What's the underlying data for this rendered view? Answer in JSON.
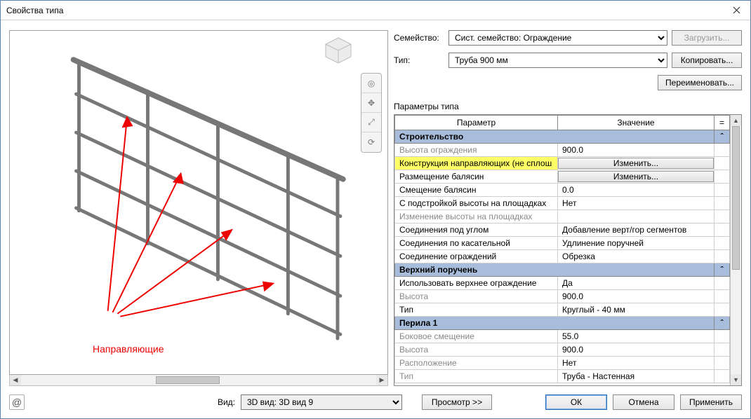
{
  "window": {
    "title": "Свойства типа"
  },
  "form": {
    "family_label": "Семейство:",
    "family_value": "Сист. семейство: Ограждение",
    "type_label": "Тип:",
    "type_value": "Труба 900 мм",
    "load_btn": "Загрузить...",
    "copy_btn": "Копировать...",
    "rename_btn": "Переименовать..."
  },
  "grid": {
    "section_label": "Параметры типа",
    "col_param": "Параметр",
    "col_value": "Значение",
    "col_eq": "=",
    "edit_label": "Изменить...",
    "groups": [
      {
        "title": "Строительство",
        "rows": [
          {
            "param": "Высота ограждения",
            "value": "900.0",
            "dim": true
          },
          {
            "param": "Конструкция направляющих (не сплош",
            "value_btn": true,
            "highlight": true
          },
          {
            "param": "Размещение балясин",
            "value_btn": true
          },
          {
            "param": "Смещение балясин",
            "value": "0.0"
          },
          {
            "param": "С подстройкой высоты на площадках",
            "value": "Нет"
          },
          {
            "param": "Изменение высоты на площадках",
            "value": "",
            "dim": true
          },
          {
            "param": "Соединения под углом",
            "value": "Добавление верт/гор сегментов"
          },
          {
            "param": "Соединения по касательной",
            "value": "Удлинение поручней"
          },
          {
            "param": "Соединение ограждений",
            "value": "Обрезка"
          }
        ]
      },
      {
        "title": "Верхний поручень",
        "rows": [
          {
            "param": "Использовать верхнее ограждение",
            "value": "Да"
          },
          {
            "param": "Высота",
            "value": "900.0",
            "dim": true
          },
          {
            "param": "Тип",
            "value": "Круглый - 40 мм"
          }
        ]
      },
      {
        "title": "Перила 1",
        "rows": [
          {
            "param": "Боковое смещение",
            "value": "55.0",
            "dim": true
          },
          {
            "param": "Высота",
            "value": "900.0",
            "dim": true
          },
          {
            "param": "Расположение",
            "value": "Нет",
            "dim": true
          },
          {
            "param": "Тип",
            "value": "Труба - Настенная",
            "dim": true
          }
        ]
      }
    ]
  },
  "preview": {
    "annotation": "Направляющие"
  },
  "footer": {
    "view_label": "Вид:",
    "view_value": "3D вид: 3D вид 9",
    "preview_btn": "Просмотр >>",
    "ok": "ОК",
    "cancel": "Отмена",
    "apply": "Применить"
  }
}
